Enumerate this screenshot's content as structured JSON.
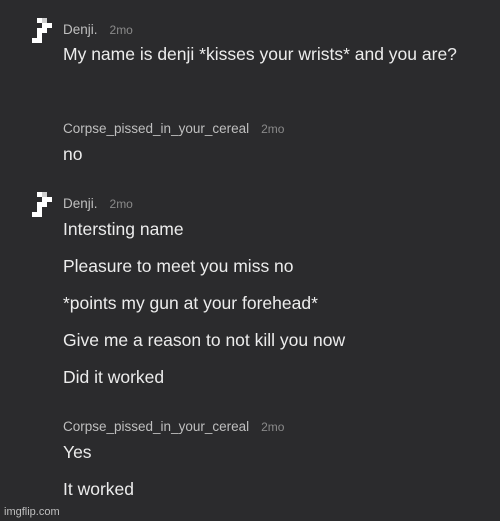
{
  "messages": [
    {
      "user": "Denji.",
      "time": "2mo",
      "has_avatar": true,
      "lines": [
        "My name is denji *kisses your wrists* and you are?"
      ]
    },
    {
      "user": "Corpse_pissed_in_your_cereal",
      "time": "2mo",
      "has_avatar": false,
      "lines": [
        "no"
      ]
    },
    {
      "user": "Denji.",
      "time": "2mo",
      "has_avatar": true,
      "lines": [
        "Intersting name",
        "Pleasure to meet you miss no",
        "*points my gun at your forehead*",
        "Give me a reason to not kill you now",
        "Did it worked"
      ]
    },
    {
      "user": "Corpse_pissed_in_your_cereal",
      "time": "2mo",
      "has_avatar": false,
      "lines": [
        "Yes",
        "It worked"
      ]
    }
  ],
  "watermark": "imgflip.com",
  "colors": {
    "background": "#2b2b2d",
    "text": "#ececec",
    "username": "#bfbfbf",
    "timestamp": "#8a8a8a"
  },
  "icons": {
    "avatar": "pixel-avatar-icon"
  }
}
